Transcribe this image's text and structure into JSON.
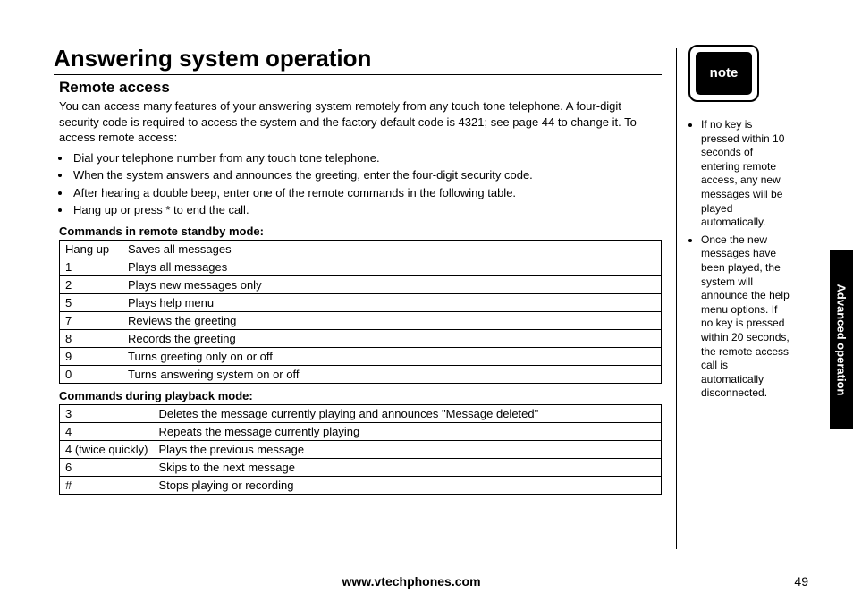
{
  "title": "Answering system operation",
  "section": "Remote access",
  "intro": "You can access many features of your answering system remotely from any touch tone telephone. A four-digit security code is required to access the system and the factory default code is 4321; see page 44 to change it. To access remote access:",
  "steps": [
    "Dial your telephone number from any touch tone telephone.",
    "When the system answers and announces the greeting, enter the four-digit security code.",
    "After hearing a double beep, enter one of the remote commands in the following table.",
    "Hang up or press * to end the call."
  ],
  "table1_title": "Commands in remote standby mode:",
  "table1": [
    {
      "k": "Hang up",
      "v": "Saves all messages"
    },
    {
      "k": "1",
      "v": "Plays all messages"
    },
    {
      "k": "2",
      "v": "Plays new messages only"
    },
    {
      "k": "5",
      "v": "Plays help menu"
    },
    {
      "k": "7",
      "v": "Reviews the greeting"
    },
    {
      "k": "8",
      "v": "Records the greeting"
    },
    {
      "k": "9",
      "v": "Turns greeting only on or off"
    },
    {
      "k": "0",
      "v": "Turns answering system on or off"
    }
  ],
  "table2_title": "Commands during playback mode:",
  "table2": [
    {
      "k": "3",
      "v": "Deletes the message currently playing and announces \"Message deleted\""
    },
    {
      "k": "4",
      "v": "Repeats the message currently playing"
    },
    {
      "k": "4 (twice quickly)",
      "v": "Plays the previous message"
    },
    {
      "k": "6",
      "v": "Skips to the next message"
    },
    {
      "k": "#",
      "v": "Stops playing or recording"
    }
  ],
  "note_label": "note",
  "notes": [
    "If no key is pressed within 10 seconds of entering remote access, any new messages will be played automatically.",
    "Once the new messages have been played, the system will announce the help menu options. If no key is pressed within 20 seconds, the remote access call is automatically disconnected."
  ],
  "side_tab": "Advanced operation",
  "footer_url": "www.vtechphones.com",
  "page_number": "49"
}
